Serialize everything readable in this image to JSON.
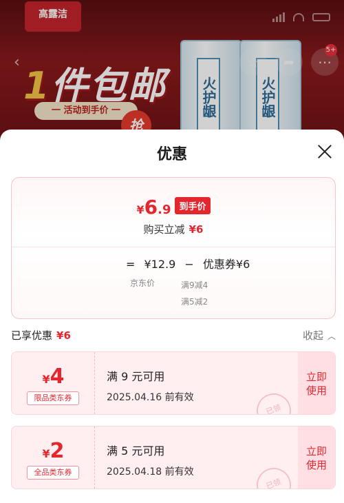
{
  "banner": {
    "brand_text": "高露洁",
    "promo_one": "1",
    "promo_rest": "件包邮",
    "promo_sub": "一 活动到手价 一",
    "promo_grab": "抢",
    "tube_label": "火护龈",
    "badge_count": "5+"
  },
  "sheet": {
    "title": "优惠"
  },
  "summary": {
    "yen": "¥",
    "price_int": "6",
    "price_dec": ".9",
    "price_tag": "到手价",
    "reduce_label": "购买立减",
    "reduce_value": "¥6",
    "calc_eq": "=",
    "calc_jd_price": "¥12.9",
    "calc_minus": "−",
    "calc_coupon": "优惠券¥6",
    "jd_price_label": "京东价",
    "coupon_rules": [
      "满9减4",
      "满5减2"
    ]
  },
  "enjoyed": {
    "label": "已享优惠",
    "value": "¥6",
    "collapse_label": "收起"
  },
  "coupons": [
    {
      "yen": "¥",
      "amount": "4",
      "type": "限品类东券",
      "condition": "满 9 元可用",
      "valid": "2025.04.16 前有效",
      "use_label_1": "立即",
      "use_label_2": "使用",
      "stamp": "已领"
    },
    {
      "yen": "¥",
      "amount": "2",
      "type": "全品类东券",
      "condition": "满 5 元可用",
      "valid": "2025.04.18 前有效",
      "use_label_1": "立即",
      "use_label_2": "使用",
      "stamp": "已领"
    }
  ],
  "colors": {
    "accent": "#e4262f",
    "banner_bg": "#8a1a1c"
  }
}
